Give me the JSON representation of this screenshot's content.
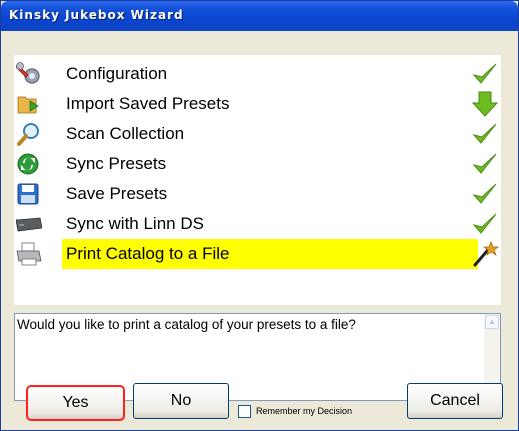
{
  "window": {
    "title": "Kinsky Jukebox Wizard"
  },
  "steps": [
    {
      "label": "Configuration",
      "icon": "wrench-gear-icon",
      "status": "checkmark-icon"
    },
    {
      "label": "Import Saved Presets",
      "icon": "folder-import-icon",
      "status": "down-arrow-icon"
    },
    {
      "label": "Scan Collection",
      "icon": "magnifier-icon",
      "status": "checkmark-icon"
    },
    {
      "label": "Sync Presets",
      "icon": "sync-icon",
      "status": "checkmark-icon"
    },
    {
      "label": "Save Presets",
      "icon": "floppy-disk-icon",
      "status": "checkmark-icon"
    },
    {
      "label": "Sync with Linn DS",
      "icon": "linn-ds-device-icon",
      "status": "checkmark-icon"
    },
    {
      "label": "Print Catalog to a File",
      "icon": "printer-icon",
      "status": "magic-wand-icon",
      "selected": true
    }
  ],
  "message": "Would you like to print a catalog of your presets to a file?",
  "buttons": {
    "yes": "Yes",
    "no": "No",
    "cancel": "Cancel"
  },
  "remember": {
    "label": "Remember my Decision",
    "checked": false
  },
  "colors": {
    "titlebar": "#0a45cf",
    "selection": "#ffff00",
    "check": "#6cbd1f",
    "focus_outline": "#ff2020"
  }
}
